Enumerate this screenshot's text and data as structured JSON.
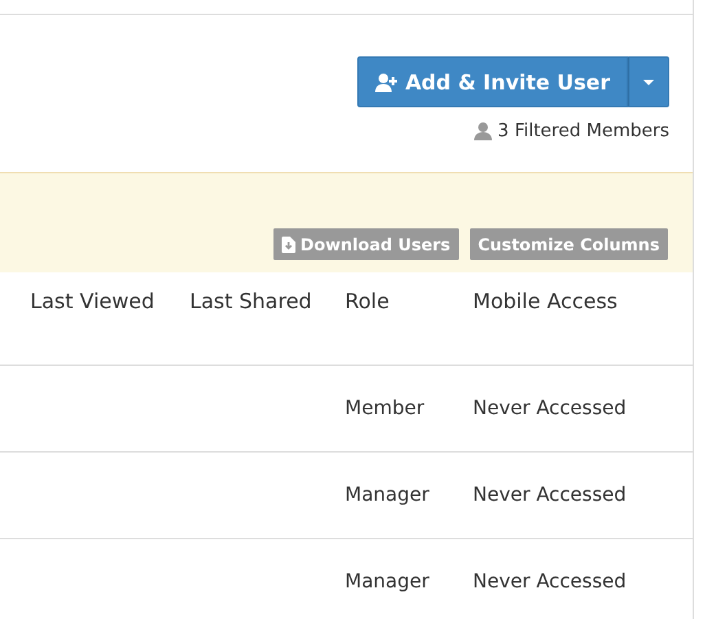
{
  "header": {
    "add_button": "Add & Invite User",
    "filtered_count": "3 Filtered Members"
  },
  "toolbar": {
    "buttons": [
      {
        "label": "Download Users",
        "kind": "download"
      },
      {
        "label": "Customize Columns",
        "kind": "plain"
      }
    ]
  },
  "table": {
    "columns": [
      "Last Viewed",
      "Last Shared",
      "Role",
      "Mobile Access"
    ],
    "rows": [
      {
        "role": "Member",
        "mobile_access": "Never Accessed"
      },
      {
        "role": "Manager",
        "mobile_access": "Never Accessed"
      },
      {
        "role": "Manager",
        "mobile_access": "Never Accessed"
      }
    ]
  }
}
